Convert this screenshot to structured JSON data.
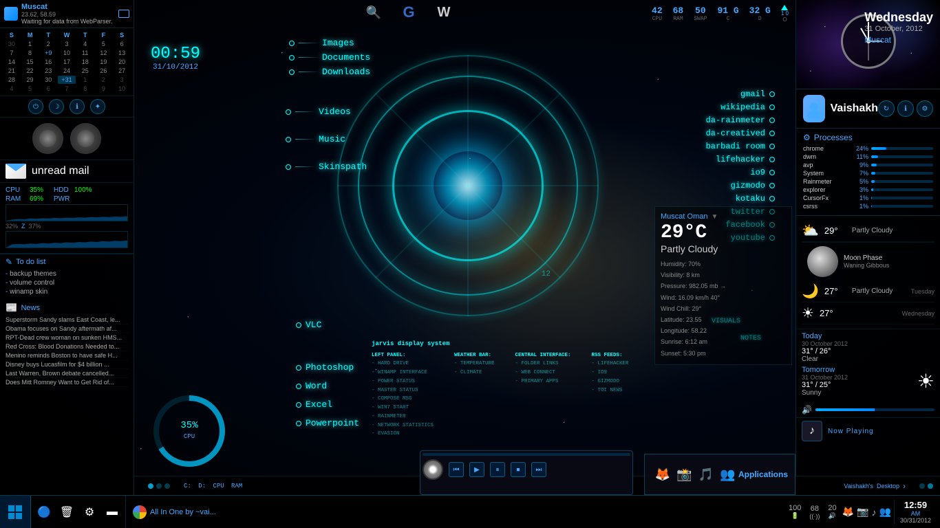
{
  "app": {
    "title": "Muscat",
    "coords": "23.62, 58.59",
    "status": "Waiting for data from WebParser."
  },
  "clock": {
    "time": "00:59",
    "date": "31/10/2012"
  },
  "calendar": {
    "days_header": [
      "S",
      "M",
      "T",
      "W",
      "T",
      "F",
      "S"
    ],
    "weeks": [
      [
        {
          "n": "30",
          "cls": "other-month"
        },
        {
          "n": "1",
          "cls": ""
        },
        {
          "n": "2",
          "cls": ""
        },
        {
          "n": "3",
          "cls": ""
        },
        {
          "n": "4",
          "cls": ""
        },
        {
          "n": "5",
          "cls": ""
        },
        {
          "n": "6",
          "cls": ""
        }
      ],
      [
        {
          "n": "7",
          "cls": ""
        },
        {
          "n": "8",
          "cls": ""
        },
        {
          "n": "+9",
          "cls": "highlighted"
        },
        {
          "n": "10",
          "cls": ""
        },
        {
          "n": "11",
          "cls": ""
        },
        {
          "n": "12",
          "cls": ""
        },
        {
          "n": "13",
          "cls": ""
        }
      ],
      [
        {
          "n": "14",
          "cls": ""
        },
        {
          "n": "15",
          "cls": ""
        },
        {
          "n": "16",
          "cls": ""
        },
        {
          "n": "17",
          "cls": ""
        },
        {
          "n": "18",
          "cls": ""
        },
        {
          "n": "19",
          "cls": ""
        },
        {
          "n": "20",
          "cls": ""
        }
      ],
      [
        {
          "n": "21",
          "cls": ""
        },
        {
          "n": "22",
          "cls": ""
        },
        {
          "n": "23",
          "cls": ""
        },
        {
          "n": "24",
          "cls": ""
        },
        {
          "n": "25",
          "cls": ""
        },
        {
          "n": "26",
          "cls": ""
        },
        {
          "n": "27",
          "cls": ""
        }
      ],
      [
        {
          "n": "28",
          "cls": ""
        },
        {
          "n": "29",
          "cls": ""
        },
        {
          "n": "30",
          "cls": ""
        },
        {
          "n": "+31",
          "cls": "today highlighted"
        },
        {
          "n": "1",
          "cls": "other-month"
        },
        {
          "n": "2",
          "cls": "other-month"
        },
        {
          "n": "3",
          "cls": "other-month"
        }
      ],
      [
        {
          "n": "4",
          "cls": "other-month"
        },
        {
          "n": "5",
          "cls": "other-month"
        },
        {
          "n": "6",
          "cls": "other-month"
        },
        {
          "n": "7",
          "cls": "other-month"
        },
        {
          "n": "8",
          "cls": "other-month"
        },
        {
          "n": "9",
          "cls": "other-month"
        },
        {
          "n": "10",
          "cls": "other-month"
        }
      ]
    ]
  },
  "controls": {
    "buttons": [
      "⏻",
      "☽",
      "ℹ",
      "✦"
    ]
  },
  "mail": {
    "label": "unread mail"
  },
  "system": {
    "cpu_label": "CPU",
    "cpu_val": "35%",
    "ram_label": "RAM",
    "ram_val": "69%",
    "hdd_label": "HDD",
    "hdd_val": "100%",
    "pwr_label": "PWR",
    "pwr_val": "",
    "vol1": "32%",
    "z_label": "Z",
    "vol2": "37%"
  },
  "todo": {
    "title": "To do list",
    "items": [
      "backup themes",
      "volume control",
      "winamp skin"
    ]
  },
  "news": {
    "title": "News",
    "items": [
      "Superstorm Sandy slams East Coast, le...",
      "Obama focuses on Sandy aftermath af...",
      "RPT-Dead crew woman on sunken HMS...",
      "Red Cross: Blood Donations Needed to...",
      "Menino reminds Boston to have safe H...",
      "Disney buys Lucasfilm for $4 billion ...",
      "Last Warren, Brown debate cancelled...",
      "Does Mitt Romney Want to Get Rid of..."
    ]
  },
  "folder_links": [
    {
      "name": "Images"
    },
    {
      "name": "Documents"
    },
    {
      "name": "Downloads"
    }
  ],
  "side_links": [
    {
      "name": "Videos"
    },
    {
      "name": "Music"
    },
    {
      "name": "Skinspath"
    }
  ],
  "right_links": [
    {
      "name": "gmail"
    },
    {
      "name": "wikipedia"
    },
    {
      "name": "da-rainmeter"
    },
    {
      "name": "da-creatived"
    },
    {
      "name": "barbadi room"
    },
    {
      "name": "lifehacker"
    },
    {
      "name": "io9"
    },
    {
      "name": "gizmodo"
    },
    {
      "name": "kotaku"
    },
    {
      "name": "twitter"
    },
    {
      "name": "facebook"
    },
    {
      "name": "youtube"
    }
  ],
  "app_shortcuts": [
    {
      "name": "VLC"
    },
    {
      "name": "Photoshop"
    },
    {
      "name": "Word"
    },
    {
      "name": "Excel"
    },
    {
      "name": "Powerpoint"
    }
  ],
  "toolbar_top": {
    "icons": [
      "🔍",
      "G",
      "W"
    ]
  },
  "status_top": [
    {
      "val": "42",
      "lbl": "CPU"
    },
    {
      "val": "68",
      "lbl": "RAM"
    },
    {
      "val": "50",
      "lbl": "SWAP"
    },
    {
      "val": "91 G",
      "lbl": "C"
    },
    {
      "val": "32 G",
      "lbl": "D"
    }
  ],
  "arrow": {
    "val": "1 0",
    "lbl": "O"
  },
  "right_panel": {
    "weekday": "Wednesday",
    "fulldate": "31 October, 2012",
    "city": "Muscat",
    "user": "Vaishakh"
  },
  "processes": {
    "title": "Processes",
    "items": [
      {
        "name": "chrome",
        "pct": "24%",
        "bar": 24
      },
      {
        "name": "dwm",
        "pct": "11%",
        "bar": 11
      },
      {
        "name": "avp",
        "pct": "9%",
        "bar": 9
      },
      {
        "name": "System",
        "pct": "7%",
        "bar": 7
      },
      {
        "name": "Rainmeter",
        "pct": "5%",
        "bar": 5
      },
      {
        "name": "explorer",
        "pct": "3%",
        "bar": 3
      },
      {
        "name": "CursorFx",
        "pct": "1%",
        "bar": 1
      },
      {
        "name": "csrss",
        "pct": "1%",
        "bar": 1
      }
    ]
  },
  "weather_forecast": [
    {
      "icon": "☀",
      "temp": "29°",
      "desc": "Partly Cloudy",
      "day": ""
    },
    {
      "icon": "🌙",
      "temp": "27°",
      "desc": "Partly Cloudy",
      "day": "Tuesday"
    },
    {
      "icon": "☀",
      "temp": "27°",
      "desc": "",
      "day": "Wednesday"
    }
  ],
  "weather_detail": {
    "location": "Muscat Oman",
    "temp": "29°C",
    "condition": "Partly Cloudy",
    "humidity": "Humidity: 70%",
    "visibility": "Visibility: 8 km",
    "pressure": "Pressure: 982.05 mb →",
    "wind": "Wind: 16.09 km/h 40°",
    "wind_chill": "Wind Chill: 29°",
    "latitude": "Latitude: 23.55",
    "longitude": "Longitude: 58.22",
    "sunrise": "Sunrise: 6:12 am",
    "sunset": "Sunset: 5:30 pm"
  },
  "moon": {
    "phase": "Moon Phase",
    "desc": "Waning Gibbous"
  },
  "today": {
    "label": "Today",
    "date": "30 October 2012",
    "temps": "31° / 26°",
    "cond": "Clear"
  },
  "tomorrow": {
    "label": "Tomorrow",
    "date": "31 October 2012",
    "temps": "31° / 25°",
    "cond": "Sunny"
  },
  "now_playing": {
    "label": "Now Playing"
  },
  "media_player": {
    "buttons": [
      "⏮",
      "▶",
      "⏸",
      "⏹",
      "⏭"
    ]
  },
  "applications": {
    "label": "Applications",
    "icons": [
      "🦊",
      "📸",
      "🎵",
      "👥"
    ]
  },
  "jarvis": {
    "title": "jarvis display system",
    "left_panel_title": "LEFT PANEL:",
    "left_items": [
      "- HARD DRIVE",
      "- WINAMP INTERFACE",
      "- POWER STATUS",
      "- MASTER STATUS",
      "- COMPOSE MSG",
      "- WIN7 START",
      "- RAINMETER",
      "- NETWORK STATISTICS",
      "- EVASION"
    ],
    "weather_bar_title": "WEATHER BAR:",
    "weather_items": [
      "- TEMPERATURE",
      "- CLIMATE"
    ],
    "visuals_label": "VISUALS",
    "notes_label": "NOTES",
    "central_title": "CENTRAL INTERFACE:",
    "central_items": [
      "- FOLDER LINKS",
      "- WEB CONNECT",
      "- PRIMARY APPS"
    ],
    "rss_title": "RSS FEEDS:",
    "rss_items": [
      "- LIFEHACKER",
      "- IO9",
      "- GIZMODO",
      "- TOI NEWS"
    ]
  },
  "taskbar": {
    "start_icon": "⊞",
    "icons": [
      "🔵",
      "🗑",
      "⚙",
      "▬"
    ],
    "browser_text": "All In One by ~vai...",
    "bottom_labels": "C: D: CPU RAM",
    "vaishakh_text": "Vaishakh's",
    "desktop_text": "Desktop",
    "systray_icons": [
      "🦊",
      "📷",
      "🎵",
      "👥",
      "🔊"
    ],
    "pwr_val": "100",
    "pwr_icon": "🔋",
    "freq_val": "68",
    "net_icon": "((·))",
    "vol_val": "20",
    "speaker_icon": "🔊",
    "time_big": "12:59",
    "time_ampm": "AM",
    "time_date": "30/31/2012"
  }
}
